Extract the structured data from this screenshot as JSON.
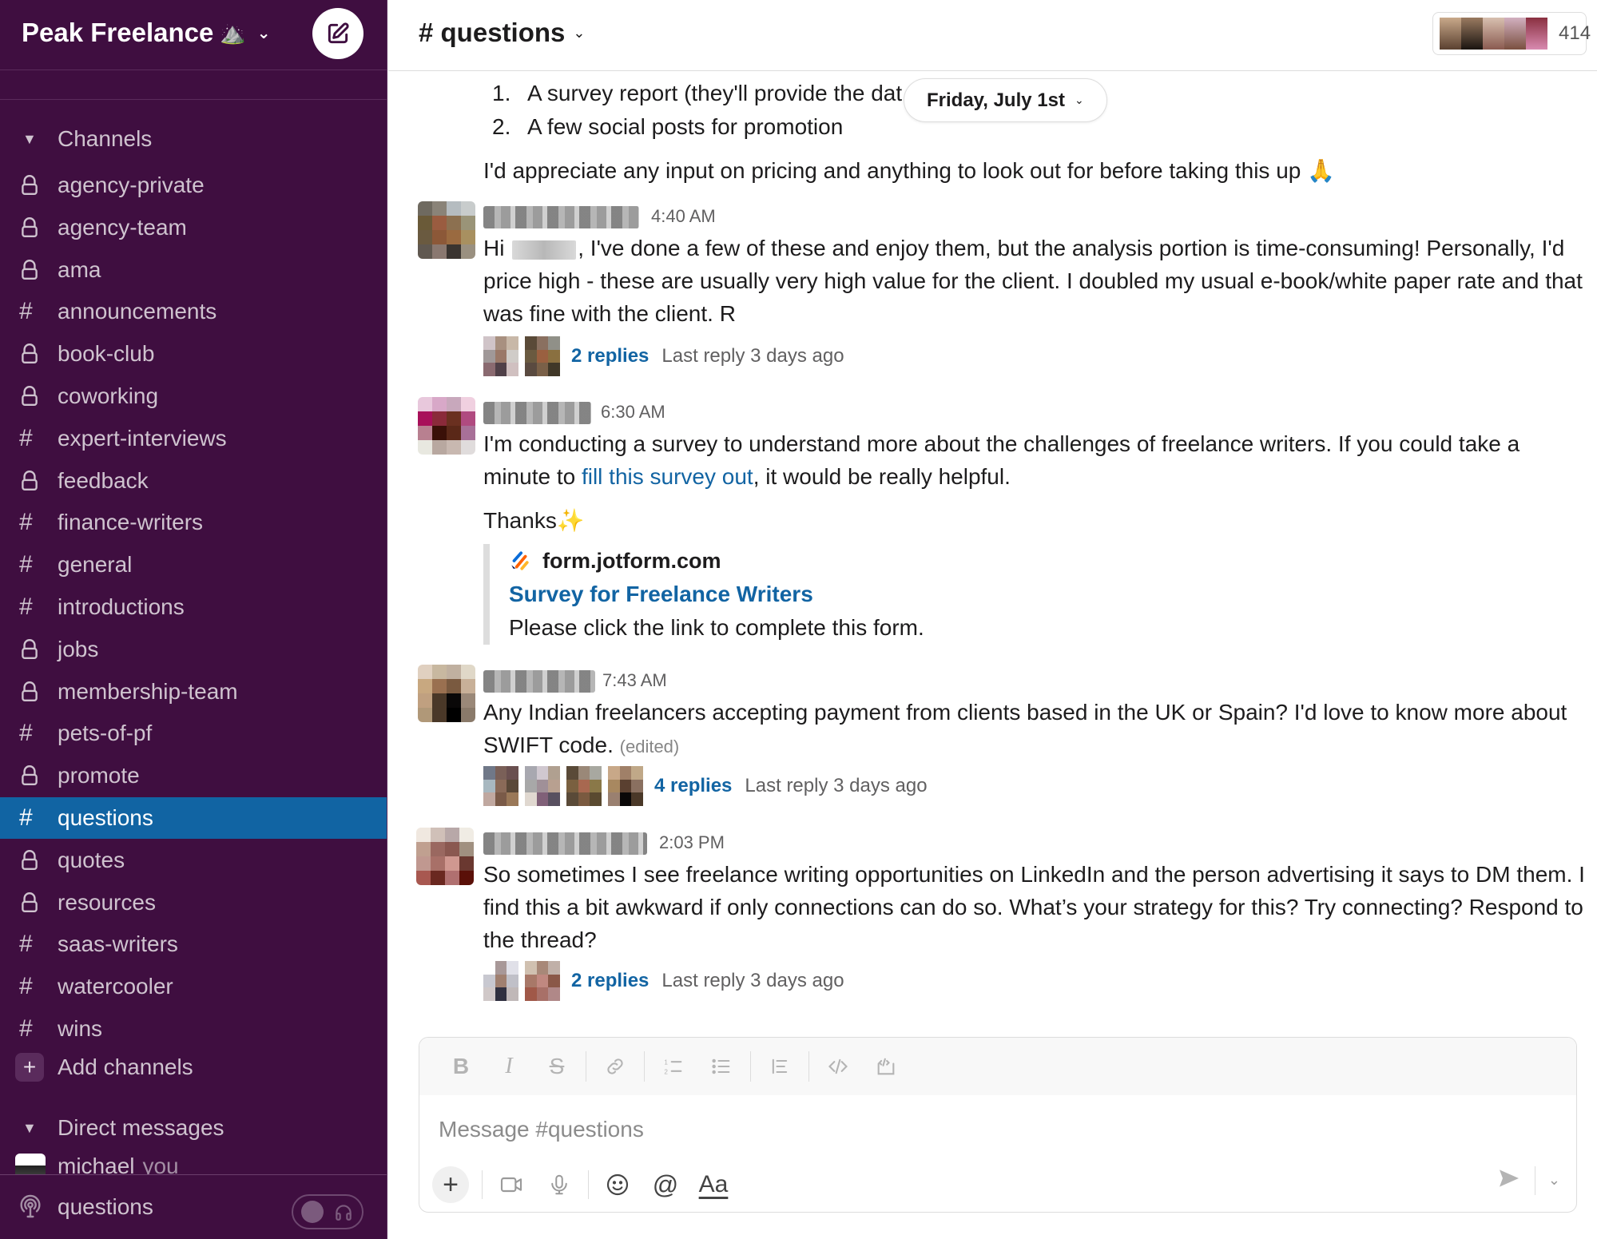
{
  "workspace": {
    "name": "Peak Freelance",
    "emoji": "⛰️",
    "compose_label": "New message"
  },
  "sidebar": {
    "channels_heading": "Channels",
    "channels": [
      {
        "name": "agency-private",
        "type": "private",
        "active": false
      },
      {
        "name": "agency-team",
        "type": "private",
        "active": false
      },
      {
        "name": "ama",
        "type": "private",
        "active": false
      },
      {
        "name": "announcements",
        "type": "public",
        "active": false
      },
      {
        "name": "book-club",
        "type": "private",
        "active": false
      },
      {
        "name": "coworking",
        "type": "private",
        "active": false
      },
      {
        "name": "expert-interviews",
        "type": "public",
        "active": false
      },
      {
        "name": "feedback",
        "type": "private",
        "active": false
      },
      {
        "name": "finance-writers",
        "type": "public",
        "active": false
      },
      {
        "name": "general",
        "type": "public",
        "active": false
      },
      {
        "name": "introductions",
        "type": "public",
        "active": false
      },
      {
        "name": "jobs",
        "type": "private",
        "active": false
      },
      {
        "name": "membership-team",
        "type": "private",
        "active": false
      },
      {
        "name": "pets-of-pf",
        "type": "public",
        "active": false
      },
      {
        "name": "promote",
        "type": "private",
        "active": false
      },
      {
        "name": "questions",
        "type": "public",
        "active": true
      },
      {
        "name": "quotes",
        "type": "private",
        "active": false
      },
      {
        "name": "resources",
        "type": "private",
        "active": false
      },
      {
        "name": "saas-writers",
        "type": "public",
        "active": false
      },
      {
        "name": "watercooler",
        "type": "public",
        "active": false
      },
      {
        "name": "wins",
        "type": "public",
        "active": false
      }
    ],
    "add_channels_label": "Add channels",
    "dm_heading": "Direct messages",
    "dm_items": [
      {
        "name": "michael",
        "suffix": "you"
      }
    ],
    "huddle": {
      "channel": "questions"
    }
  },
  "channel_header": {
    "title": "# questions",
    "member_count": "414"
  },
  "date_divider": {
    "label": "Friday, July 1st"
  },
  "messages": {
    "partial": {
      "list": [
        {
          "num": "1.",
          "text": "A survey report (they'll provide the dat"
        },
        {
          "num": "2.",
          "text": "A few social posts for promotion"
        }
      ],
      "text": "I'd appreciate any input on pricing and anything to look out for before taking this up",
      "emoji": "🙏"
    },
    "items": [
      {
        "time": "4:40 AM",
        "text_prefix": "Hi",
        "text": ", I've done a few of these and enjoy them, but the analysis portion is time-consuming! Personally, I'd price high - these are usually very high value for the client. I doubled my usual e-book/white paper rate and that was fine with the client. R",
        "replies": "2 replies",
        "last_reply": "Last reply 3 days ago"
      },
      {
        "time": "6:30 AM",
        "text_before_link": "I'm conducting a survey to understand more about the challenges of freelance writers. If you could take a minute to ",
        "link_text": "fill this survey out",
        "text_after_link": ", it would be really helpful.",
        "thanks": "Thanks",
        "thanks_emoji": "✨",
        "unfurl": {
          "site": "form.jotform.com",
          "title": "Survey for Freelance Writers",
          "description": "Please click the link to complete this form."
        }
      },
      {
        "time": "7:43 AM",
        "text": "Any Indian freelancers accepting payment from clients based in the UK or Spain? I'd love to know more about SWIFT code.",
        "edited": "(edited)",
        "replies": "4 replies",
        "last_reply": "Last reply 3 days ago"
      },
      {
        "time": "2:03 PM",
        "text": "So sometimes I see freelance writing opportunities on LinkedIn and the person advertising it says to DM them. I find this a bit awkward if only connections can do so. What’s your strategy for this? Try connecting? Respond to the thread?",
        "replies": "2 replies",
        "last_reply": "Last reply 3 days ago"
      }
    ]
  },
  "composer": {
    "placeholder": "Message #questions",
    "format_buttons": [
      "bold",
      "italic",
      "strikethrough",
      "link",
      "ordered-list",
      "bulleted-list",
      "blockquote",
      "code",
      "code-block"
    ],
    "aa_label": "Aa"
  }
}
